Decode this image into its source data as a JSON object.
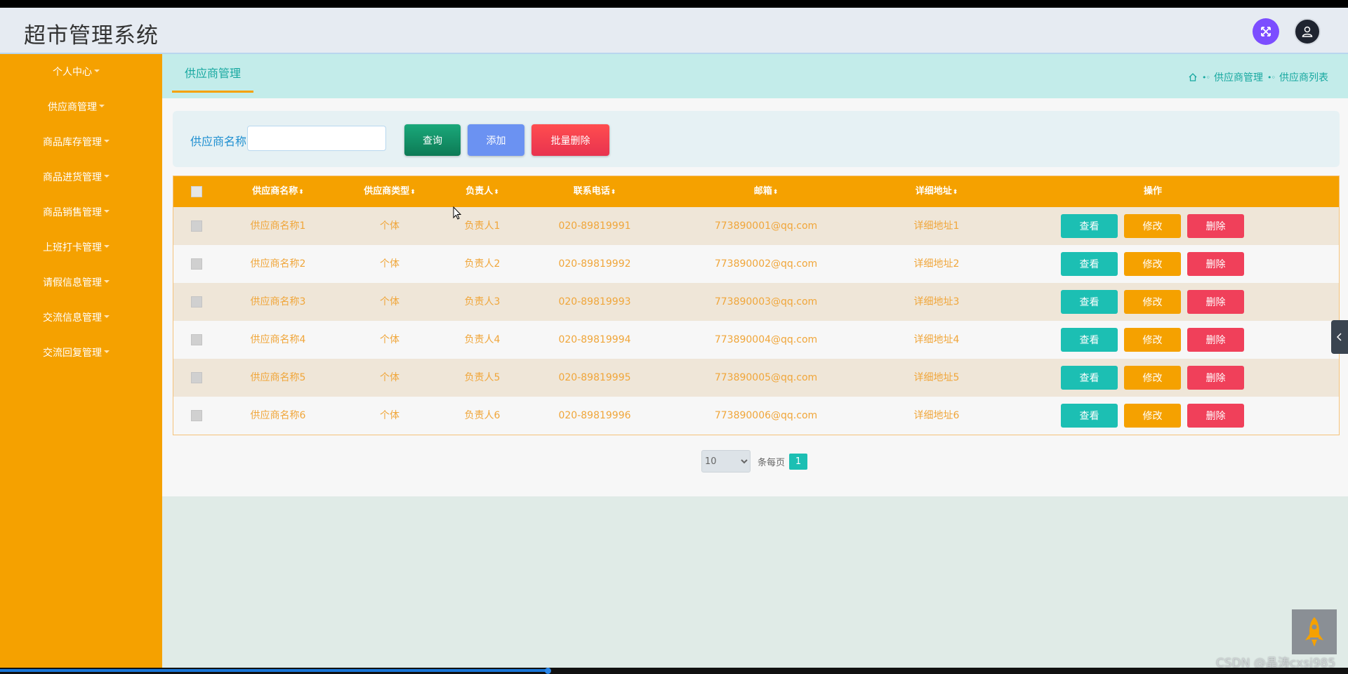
{
  "app": {
    "title": "超市管理系统"
  },
  "sidebar": {
    "items": [
      {
        "label": "个人中心"
      },
      {
        "label": "供应商管理"
      },
      {
        "label": "商品库存管理"
      },
      {
        "label": "商品进货管理"
      },
      {
        "label": "商品销售管理"
      },
      {
        "label": "上班打卡管理"
      },
      {
        "label": "请假信息管理"
      },
      {
        "label": "交流信息管理"
      },
      {
        "label": "交流回复管理"
      }
    ]
  },
  "tab": {
    "label": "供应商管理"
  },
  "breadcrumb": {
    "items": [
      "供应商管理",
      "供应商列表"
    ]
  },
  "search": {
    "label": "供应商名称",
    "value": "",
    "placeholder": "",
    "query_label": "查询",
    "add_label": "添加",
    "batch_delete_label": "批量删除"
  },
  "table": {
    "columns": [
      "供应商名称",
      "供应商类型",
      "负责人",
      "联系电话",
      "邮箱",
      "详细地址",
      "操作"
    ],
    "rows": [
      [
        "供应商名称1",
        "个体",
        "负责人1",
        "020-89819991",
        "773890001@qq.com",
        "详细地址1"
      ],
      [
        "供应商名称2",
        "个体",
        "负责人2",
        "020-89819992",
        "773890002@qq.com",
        "详细地址2"
      ],
      [
        "供应商名称3",
        "个体",
        "负责人3",
        "020-89819993",
        "773890003@qq.com",
        "详细地址3"
      ],
      [
        "供应商名称4",
        "个体",
        "负责人4",
        "020-89819994",
        "773890004@qq.com",
        "详细地址4"
      ],
      [
        "供应商名称5",
        "个体",
        "负责人5",
        "020-89819995",
        "773890005@qq.com",
        "详细地址5"
      ],
      [
        "供应商名称6",
        "个体",
        "负责人6",
        "020-89819996",
        "773890006@qq.com",
        "详细地址6"
      ]
    ],
    "actions": {
      "view": "查看",
      "edit": "修改",
      "delete": "删除"
    }
  },
  "pagination": {
    "page_size": "10",
    "per_page_label": "条每页",
    "current_page": "1"
  },
  "watermark": "CSDN @晶涛cxsj985",
  "colors": {
    "sidebar_bg": "#f5a100",
    "accent_teal": "#1cbfb3",
    "danger": "#f0405a",
    "primary_blue": "#6b92f2",
    "header_bg": "#e6ebf2"
  }
}
